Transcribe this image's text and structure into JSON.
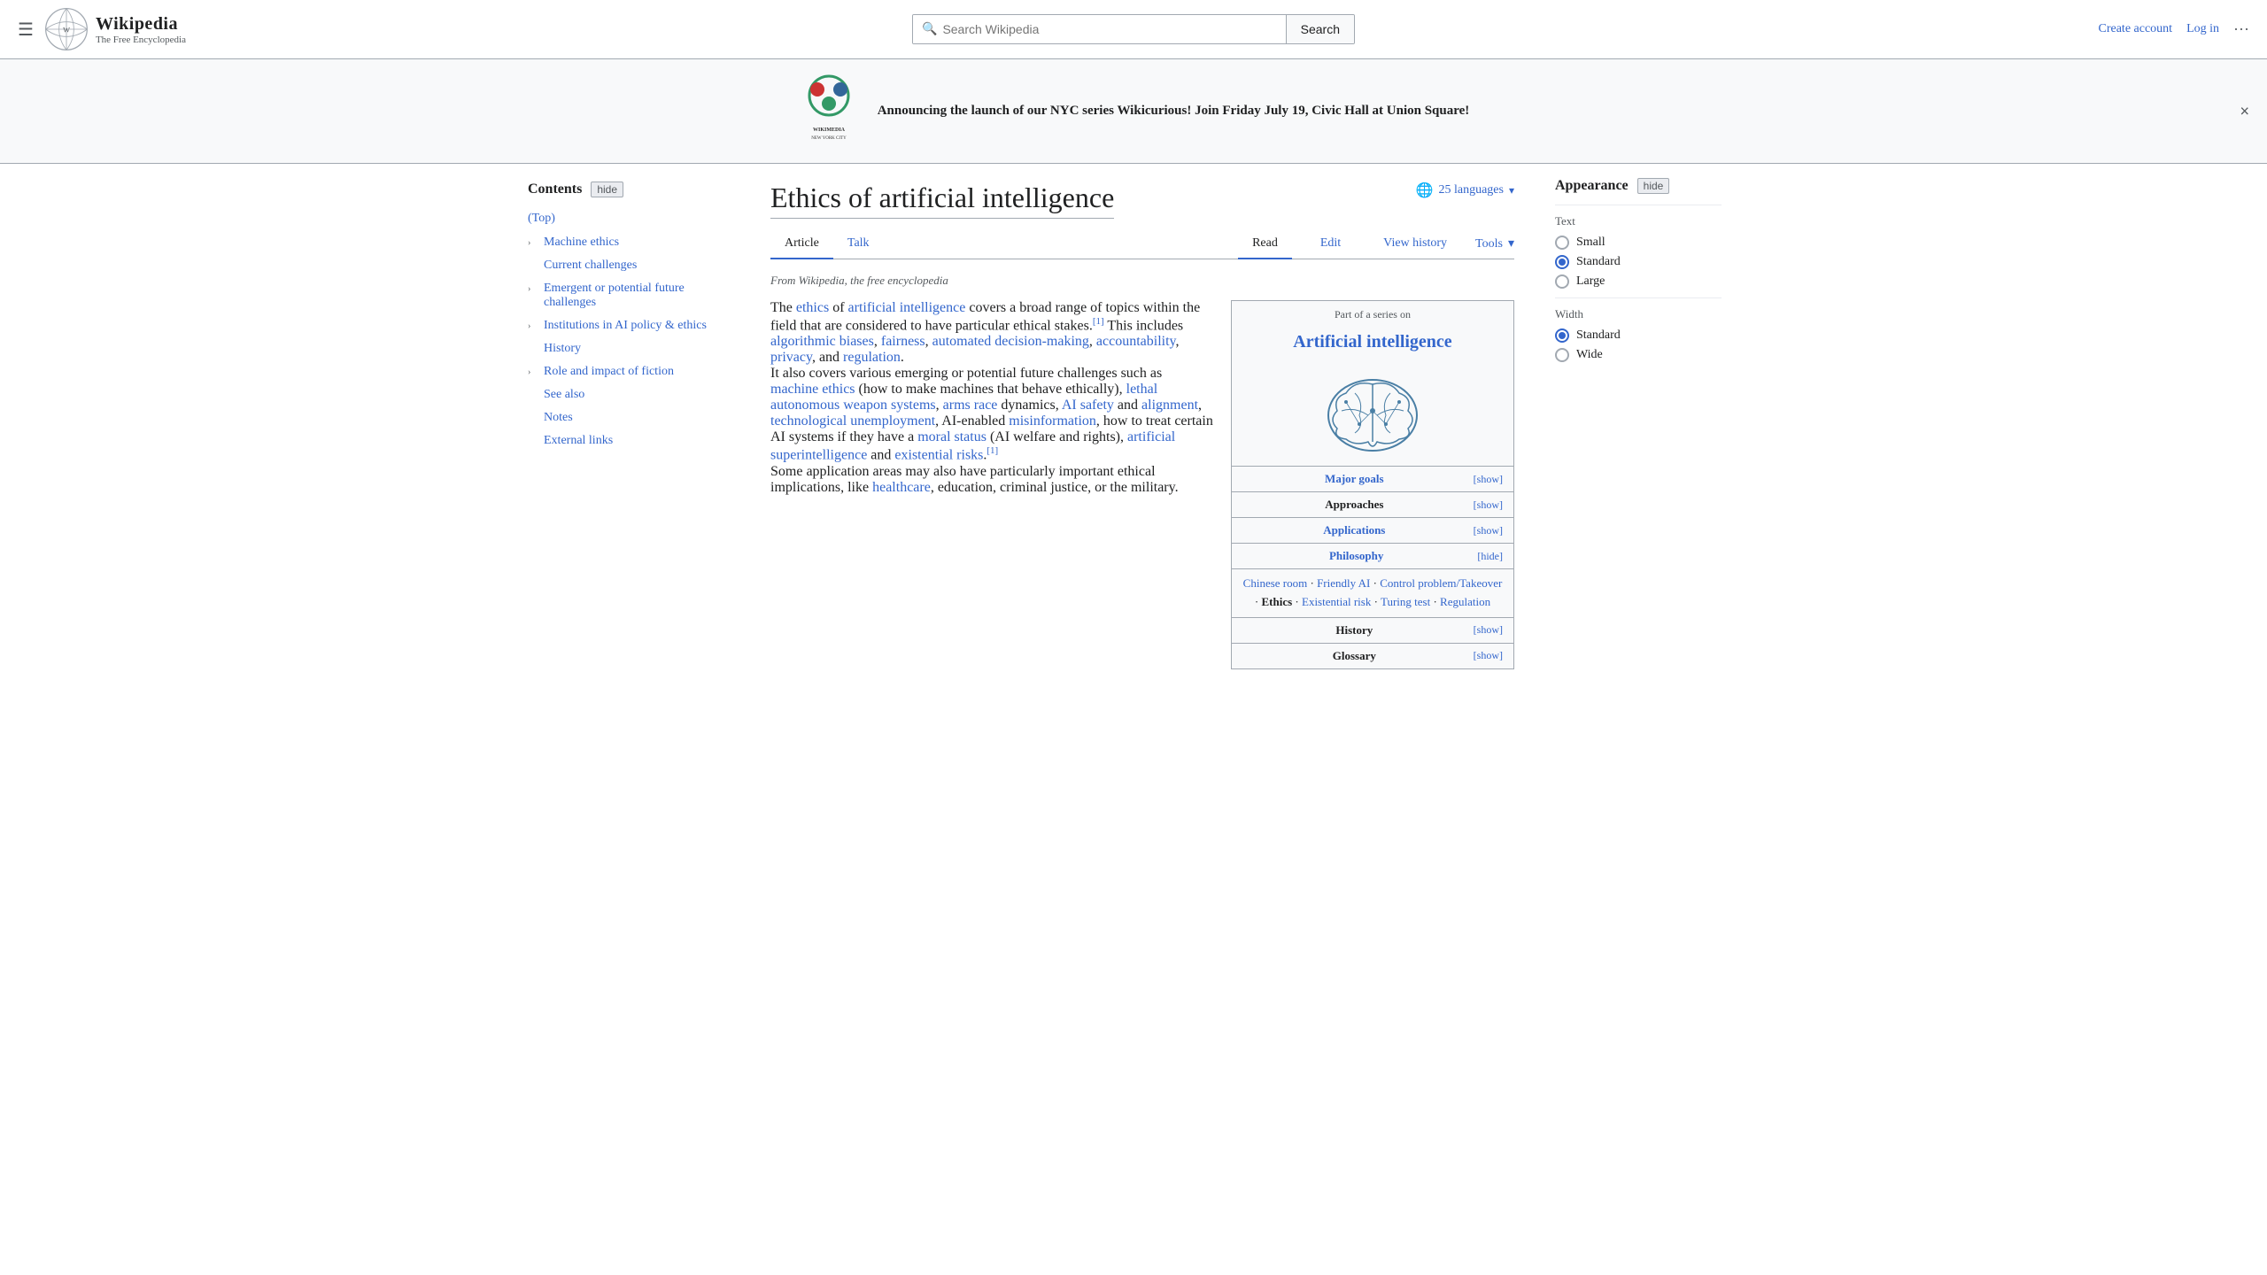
{
  "header": {
    "hamburger": "☰",
    "logo_alt": "Wikipedia globe",
    "site_name": "Wikipedia",
    "site_tagline": "The Free Encyclopedia",
    "search_placeholder": "Search Wikipedia",
    "search_button": "Search",
    "create_account": "Create account",
    "log_in": "Log in",
    "more": "···"
  },
  "banner": {
    "text": "Announcing the launch of our NYC series Wikicurious! Join Friday July 19, Civic Hall at Union Square!",
    "close": "×"
  },
  "page": {
    "title": "Ethics of artificial intelligence",
    "from_wiki": "From Wikipedia, the free encyclopedia",
    "languages_count": "25 languages",
    "tabs": {
      "article": "Article",
      "talk": "Talk",
      "read": "Read",
      "edit": "Edit",
      "view_history": "View history",
      "tools": "Tools"
    }
  },
  "article": {
    "intro_parts": [
      {
        "text": "The ",
        "type": "plain"
      },
      {
        "text": "ethics",
        "type": "link"
      },
      {
        "text": " of ",
        "type": "plain"
      },
      {
        "text": "artificial intelligence",
        "type": "link"
      },
      {
        "text": " covers a broad range of topics within the field that are considered to have particular ethical stakes.",
        "type": "plain"
      }
    ],
    "p1_after_ref": " This includes ",
    "p1_links": [
      "algorithmic biases",
      "fairness",
      "automated decision-making",
      "accountability",
      "privacy"
    ],
    "p1_end": ", and ",
    "p1_last_link": "regulation",
    "p2_start": "It also covers various emerging or potential future challenges such as ",
    "p2_links": [
      "machine ethics",
      "lethal autonomous weapon systems",
      "arms race"
    ],
    "p2_mid": " dynamics, ",
    "p2_links2": [
      "AI safety",
      "alignment",
      "technological unemployment"
    ],
    "p2_mid2": ", AI-enabled ",
    "p2_link3": "misinformation",
    "p2_mid3": ", how to treat certain AI systems if they have a ",
    "p2_link4": "moral status",
    "p2_mid4": " (AI welfare and rights), ",
    "p2_link5": "artificial superintelligence",
    "p2_mid5": " and ",
    "p2_link6": "existential risks",
    "p3_start": "Some application areas may also have particularly important ethical implications, like ",
    "p3_link": "healthcare",
    "p3_end": ", education, criminal justice, or the military."
  },
  "infobox": {
    "header": "Part of a series on",
    "title": "Artificial intelligence",
    "rows": [
      {
        "label": "Major goals",
        "show": "[show]",
        "blue": true
      },
      {
        "label": "Approaches",
        "show": "[show]",
        "blue": false
      },
      {
        "label": "Applications",
        "show": "[show]",
        "blue": true
      },
      {
        "label": "Philosophy",
        "show": "[hide]",
        "blue": true
      }
    ],
    "philosophy_links": [
      "Chinese room",
      "·",
      "Friendly AI",
      "·",
      "Control problem/Takeover",
      "·",
      "Ethics",
      "·",
      "Existential risk",
      "·",
      "Turing test",
      "·",
      "Regulation"
    ],
    "bottom_rows": [
      {
        "label": "History",
        "show": "[show]",
        "blue": false
      },
      {
        "label": "Glossary",
        "show": "[show]",
        "blue": false
      }
    ]
  },
  "toc": {
    "title": "Contents",
    "hide_btn": "hide",
    "top": "(Top)",
    "items": [
      {
        "label": "Machine ethics",
        "has_sub": true
      },
      {
        "label": "Current challenges",
        "has_sub": false
      },
      {
        "label": "Emergent or potential future challenges",
        "has_sub": true
      },
      {
        "label": "Institutions in AI policy & ethics",
        "has_sub": true
      },
      {
        "label": "History",
        "has_sub": false,
        "plain": true
      },
      {
        "label": "Role and impact of fiction",
        "has_sub": true
      },
      {
        "label": "See also",
        "has_sub": false,
        "plain": true
      },
      {
        "label": "Notes",
        "has_sub": false,
        "plain": true
      },
      {
        "label": "External links",
        "has_sub": false,
        "plain": true
      }
    ]
  },
  "appearance": {
    "title": "Appearance",
    "hide_btn": "hide",
    "text_label": "Text",
    "text_options": [
      {
        "label": "Small",
        "selected": false
      },
      {
        "label": "Standard",
        "selected": true
      },
      {
        "label": "Large",
        "selected": false
      }
    ],
    "width_label": "Width",
    "width_options": [
      {
        "label": "Standard",
        "selected": true
      },
      {
        "label": "Wide",
        "selected": false
      }
    ]
  }
}
